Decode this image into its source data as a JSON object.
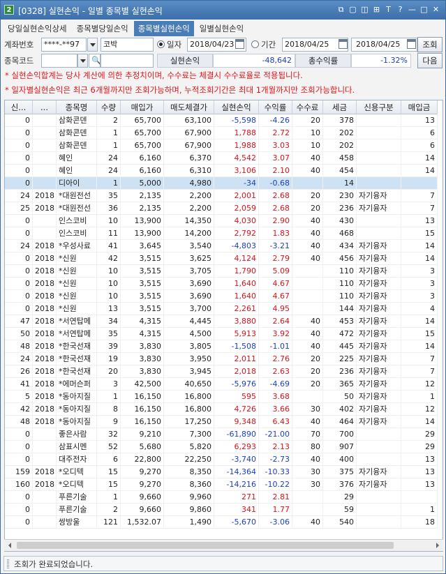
{
  "window": {
    "title": "[0328] 실현손익 - 일별 종목별 실현손익",
    "app_icon": "2",
    "title_buttons": [
      "link-icon",
      "copy-icon",
      "window-icon",
      "tile-icon",
      "font-icon",
      "help-icon",
      "minimize-icon",
      "maximize-icon",
      "close-icon"
    ]
  },
  "tabs": [
    {
      "label": "당일실현손익상세",
      "active": false
    },
    {
      "label": "종목별당일손익",
      "active": false
    },
    {
      "label": "종목별실현손익",
      "active": true
    },
    {
      "label": "일별실현손익",
      "active": false
    }
  ],
  "controls": {
    "account_label": "계좌번호",
    "account_value": "****-**97",
    "account_name": "코박",
    "date_radio_label": "일자",
    "date_value": "2018/04/23",
    "period_radio_label": "기간",
    "period_from": "2018/04/25",
    "period_sep": "~",
    "period_to": "2018/04/25",
    "query_button": "조회",
    "code_label": "종목코드",
    "code_value": "",
    "code_name_value": "",
    "realized_label": "실현손익",
    "realized_value": "-48,642",
    "rate_label": "총수익률",
    "rate_value": "-1.32%",
    "next_button": "다음"
  },
  "notices": [
    "* 실현손익합계는 당사 계산에 의한 추정치이며, 수수료는 체결시 수수료율로 적용됩니다.",
    "* 일자별실현손익은 최근 6개월까지만 조회가능하며, 누적조회기간은 최대 1개월까지만 조회가능합니다."
  ],
  "grid": {
    "columns": [
      "신...",
      "...",
      "종목명",
      "수량",
      "매입가",
      "매도체결가",
      "실현손익",
      "수익률",
      "수수료",
      "세금",
      "신용구분",
      "매입금"
    ],
    "selected_row": 5,
    "rows": [
      [
        "0",
        "",
        "삼화콘덴",
        "2",
        "65,700",
        "63,100",
        "-5,598",
        "-4.26",
        "20",
        "378",
        "",
        "13"
      ],
      [
        "0",
        "",
        "삼화콘덴",
        "1",
        "65,700",
        "67,900",
        "1,788",
        "2.72",
        "10",
        "202",
        "",
        "6"
      ],
      [
        "0",
        "",
        "삼화콘덴",
        "1",
        "65,700",
        "67,900",
        "1,988",
        "3.03",
        "10",
        "202",
        "",
        "6"
      ],
      [
        "0",
        "",
        "혜인",
        "24",
        "6,160",
        "6,370",
        "4,542",
        "3.07",
        "40",
        "458",
        "",
        "14"
      ],
      [
        "0",
        "",
        "혜인",
        "24",
        "6,160",
        "6,310",
        "3,106",
        "2.10",
        "40",
        "454",
        "",
        "14"
      ],
      [
        "0",
        "",
        "디아이",
        "1",
        "5,000",
        "4,980",
        "-34",
        "-0.68",
        "",
        "14",
        "",
        ""
      ],
      [
        "24",
        "2018",
        "*대원전선",
        "35",
        "2,135",
        "2,200",
        "2,001",
        "2.68",
        "20",
        "230",
        "자기융자",
        "7"
      ],
      [
        "25",
        "2018",
        "*대원전선",
        "36",
        "2,135",
        "2,200",
        "2,059",
        "2.68",
        "20",
        "236",
        "자기융자",
        "7"
      ],
      [
        "0",
        "",
        "인스코비",
        "10",
        "13,900",
        "14,350",
        "4,030",
        "2.90",
        "40",
        "430",
        "",
        "13"
      ],
      [
        "0",
        "",
        "인스코비",
        "11",
        "13,900",
        "14,200",
        "2,792",
        "1.83",
        "40",
        "468",
        "",
        "15"
      ],
      [
        "24",
        "2018",
        "*우성사료",
        "41",
        "3,645",
        "3,540",
        "-4,803",
        "-3.21",
        "40",
        "434",
        "자기융자",
        "14"
      ],
      [
        "0",
        "2018",
        "*신원",
        "42",
        "3,515",
        "3,625",
        "4,124",
        "2.79",
        "40",
        "456",
        "자기융자",
        "14"
      ],
      [
        "0",
        "2018",
        "*신원",
        "10",
        "3,515",
        "3,705",
        "1,790",
        "5.09",
        "",
        "110",
        "자기융자",
        "3"
      ],
      [
        "0",
        "2018",
        "*신원",
        "10",
        "3,515",
        "3,690",
        "1,640",
        "4.67",
        "",
        "110",
        "자기융자",
        "3"
      ],
      [
        "0",
        "2018",
        "*신원",
        "10",
        "3,515",
        "3,690",
        "1,640",
        "4.67",
        "",
        "110",
        "자기융자",
        "3"
      ],
      [
        "0",
        "2018",
        "*신원",
        "13",
        "3,515",
        "3,700",
        "2,261",
        "4.95",
        "",
        "144",
        "자기융자",
        "4"
      ],
      [
        "47",
        "2018",
        "*서연탑메",
        "34",
        "4,315",
        "4,445",
        "3,880",
        "2.64",
        "40",
        "453",
        "자기융자",
        "14"
      ],
      [
        "50",
        "2018",
        "*서연탑메",
        "35",
        "4,315",
        "4,500",
        "5,913",
        "3.92",
        "40",
        "472",
        "자기융자",
        "15"
      ],
      [
        "48",
        "2018",
        "*한국선재",
        "39",
        "3,830",
        "3,805",
        "-1,508",
        "-1.01",
        "40",
        "445",
        "자기융자",
        "14"
      ],
      [
        "24",
        "2018",
        "*한국선재",
        "19",
        "3,830",
        "3,950",
        "2,011",
        "2.76",
        "20",
        "225",
        "자기융자",
        "7"
      ],
      [
        "26",
        "2018",
        "*한국선재",
        "20",
        "3,830",
        "3,945",
        "2,018",
        "2.63",
        "20",
        "236",
        "자기융자",
        "7"
      ],
      [
        "41",
        "2018",
        "*에머슨퍼",
        "3",
        "42,500",
        "40,650",
        "-5,976",
        "-4.69",
        "20",
        "365",
        "자기융자",
        "12"
      ],
      [
        "5",
        "2018",
        "*동아지질",
        "1",
        "16,150",
        "16,800",
        "595",
        "3.68",
        "",
        "50",
        "자기융자",
        "1"
      ],
      [
        "42",
        "2018",
        "*동아지질",
        "8",
        "16,150",
        "16,800",
        "4,726",
        "3.66",
        "30",
        "402",
        "자기융자",
        "12"
      ],
      [
        "48",
        "2018",
        "*동아지질",
        "9",
        "16,150",
        "17,250",
        "9,348",
        "6.43",
        "40",
        "464",
        "자기융자",
        "14"
      ],
      [
        "0",
        "",
        "좋은사람",
        "32",
        "9,210",
        "7,300",
        "-61,890",
        "-21.00",
        "70",
        "700",
        "",
        "29"
      ],
      [
        "0",
        "",
        "삼표시멘",
        "52",
        "5,680",
        "5,820",
        "6,293",
        "2.13",
        "80",
        "907",
        "",
        "29"
      ],
      [
        "0",
        "",
        "대주전자",
        "6",
        "22,800",
        "22,250",
        "-3,740",
        "-2.73",
        "40",
        "400",
        "",
        "13"
      ],
      [
        "159",
        "2018",
        "*오디텍",
        "15",
        "9,270",
        "8,350",
        "-14,364",
        "-10.33",
        "30",
        "375",
        "자기융자",
        "13"
      ],
      [
        "160",
        "2018",
        "*오디텍",
        "15",
        "9,270",
        "8,360",
        "-14,216",
        "-10.22",
        "30",
        "376",
        "자기융자",
        "13"
      ],
      [
        "0",
        "",
        "푸른기술",
        "1",
        "9,660",
        "9,960",
        "271",
        "2.81",
        "",
        "29",
        "",
        ""
      ],
      [
        "0",
        "",
        "푸른기술",
        "2",
        "9,660",
        "9,860",
        "341",
        "1.77",
        "",
        "59",
        "",
        "1"
      ],
      [
        "0",
        "",
        "쌍방울",
        "121",
        "1,532.07",
        "1,490",
        "-5,670",
        "-3.06",
        "40",
        "540",
        "",
        "18"
      ]
    ]
  },
  "status": {
    "message": "조회가 완료되었습니다."
  }
}
